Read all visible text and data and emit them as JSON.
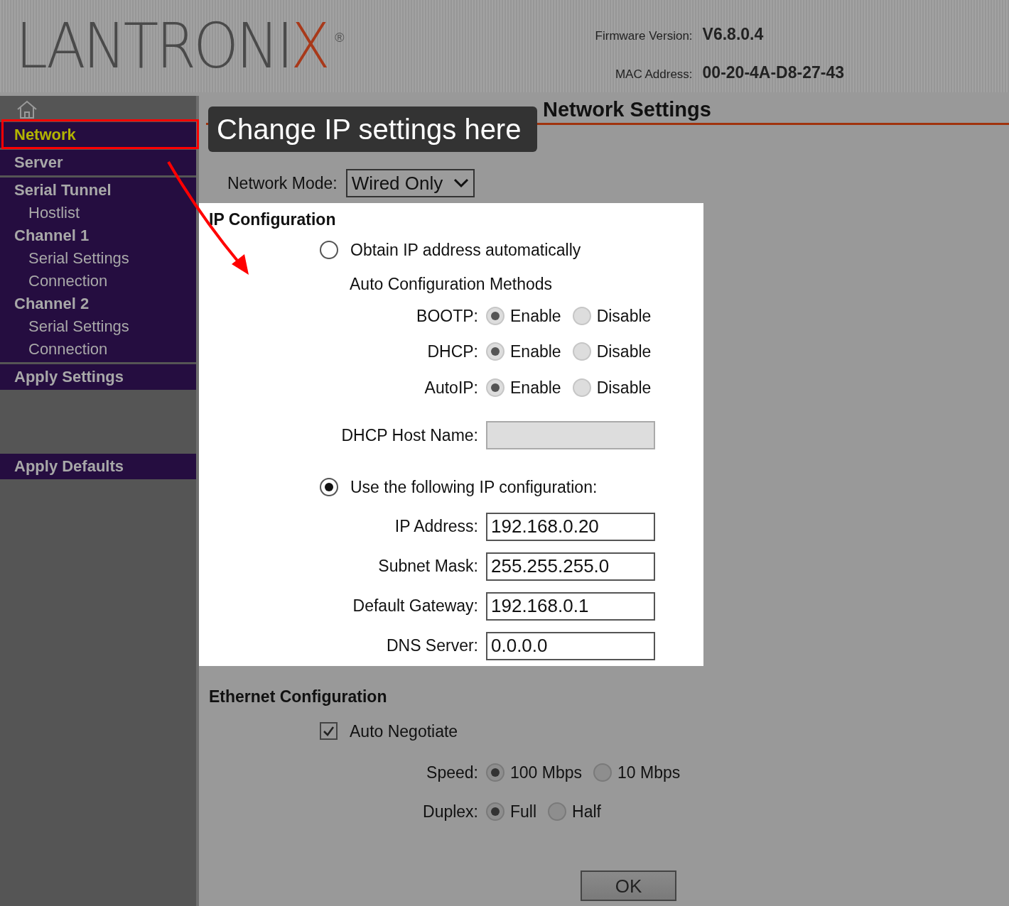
{
  "header": {
    "logo": "LANTRONIX",
    "logo_mark": "®",
    "firmware_label": "Firmware Version:",
    "firmware_value": "V6.8.0.4",
    "mac_label": "MAC Address:",
    "mac_value": "00-20-4A-D8-27-43"
  },
  "sidebar": {
    "groups": [
      {
        "kind": "menu",
        "items": [
          {
            "label": "Network",
            "kind": "top",
            "selected": true
          }
        ]
      },
      {
        "kind": "menu",
        "items": [
          {
            "label": "Server",
            "kind": "top",
            "selected": false
          }
        ]
      },
      {
        "kind": "menu",
        "items": [
          {
            "label": "Serial Tunnel",
            "kind": "top",
            "selected": false
          },
          {
            "label": "Hostlist",
            "kind": "sub",
            "selected": false
          },
          {
            "label": "Channel 1",
            "kind": "top",
            "selected": false
          },
          {
            "label": "Serial Settings",
            "kind": "sub",
            "selected": false
          },
          {
            "label": "Connection",
            "kind": "sub",
            "selected": false
          },
          {
            "label": "Channel 2",
            "kind": "top",
            "selected": false
          },
          {
            "label": "Serial Settings",
            "kind": "sub",
            "selected": false
          },
          {
            "label": "Connection",
            "kind": "sub",
            "selected": false
          }
        ]
      },
      {
        "kind": "menu",
        "items": [
          {
            "label": "Apply Settings",
            "kind": "top",
            "selected": false
          }
        ]
      },
      {
        "kind": "bottom",
        "items": [
          {
            "label": "Apply Defaults",
            "kind": "top",
            "selected": false
          }
        ]
      }
    ]
  },
  "annotation": {
    "callout": "Change IP settings here"
  },
  "page_title": "Network Settings",
  "network_mode": {
    "label": "Network Mode:",
    "value": "Wired Only"
  },
  "ip_configuration": {
    "title": "IP Configuration",
    "obtain": {
      "label": "Obtain IP address automatically",
      "selected": false
    },
    "methods_title": "Auto Configuration Methods",
    "methods": [
      {
        "label": "BOOTP:",
        "options": [
          {
            "label": "Enable",
            "selected": true
          },
          {
            "label": "Disable",
            "selected": false
          }
        ]
      },
      {
        "label": "DHCP:",
        "options": [
          {
            "label": "Enable",
            "selected": true
          },
          {
            "label": "Disable",
            "selected": false
          }
        ]
      },
      {
        "label": "AutoIP:",
        "options": [
          {
            "label": "Enable",
            "selected": true
          },
          {
            "label": "Disable",
            "selected": false
          }
        ]
      }
    ],
    "host_name_label": "DHCP Host Name:",
    "static": {
      "label": "Use the following IP configuration:",
      "selected": true
    },
    "fields": [
      {
        "label": "IP Address:",
        "value": "192.168.0.20"
      },
      {
        "label": "Subnet Mask:",
        "value": "255.255.255.0"
      },
      {
        "label": "Default Gateway:",
        "value": "192.168.0.1"
      },
      {
        "label": "DNS Server:",
        "value": "0.0.0.0"
      }
    ]
  },
  "ethernet": {
    "title": "Ethernet Configuration",
    "auto_negotiate": {
      "label": "Auto Negotiate",
      "checked": true
    },
    "settings": [
      {
        "label": "Speed:",
        "options": [
          {
            "label": "100 Mbps",
            "selected": true
          },
          {
            "label": "10 Mbps",
            "selected": false
          }
        ]
      },
      {
        "label": "Duplex:",
        "options": [
          {
            "label": "Full",
            "selected": true
          },
          {
            "label": "Half",
            "selected": false
          }
        ]
      }
    ]
  },
  "ok_button": "OK"
}
